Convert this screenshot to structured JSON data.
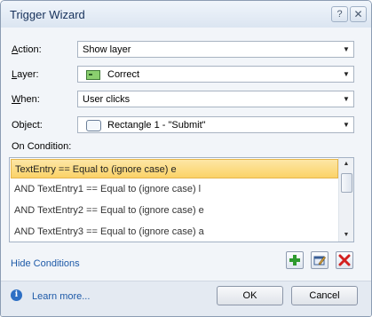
{
  "window": {
    "title": "Trigger Wizard",
    "help_glyph": "?",
    "close_glyph": "✕"
  },
  "form": {
    "action": {
      "label_mnemonic": "A",
      "label_rest": "ction:",
      "value": "Show layer"
    },
    "layer": {
      "label_mnemonic": "L",
      "label_rest": "ayer:",
      "value": "Correct",
      "icon": "layer-icon"
    },
    "when": {
      "label_mnemonic": "W",
      "label_rest": "hen:",
      "value": "User clicks"
    },
    "object": {
      "label": "Object:",
      "value": "Rectangle 1 - \"Submit\"",
      "icon": "rectangle-shape-icon"
    }
  },
  "conditions": {
    "label": "On Condition:",
    "items": [
      "TextEntry == Equal to (ignore case) e",
      "AND TextEntry1 == Equal to (ignore case) l",
      "AND TextEntry2 == Equal to (ignore case) e",
      "AND TextEntry3 == Equal to (ignore case) a"
    ],
    "selected_index": 0,
    "hide_link": "Hide Conditions"
  },
  "toolbar": {
    "add_icon": "add-icon",
    "edit_icon": "edit-icon",
    "delete_icon": "delete-icon"
  },
  "footer": {
    "learn_more": "Learn more...",
    "ok_label": "OK",
    "cancel_label": "Cancel"
  },
  "colors": {
    "selection": "#fbd267",
    "link": "#1e5aa8",
    "add_green": "#2e9a2e",
    "delete_red": "#d32020"
  }
}
